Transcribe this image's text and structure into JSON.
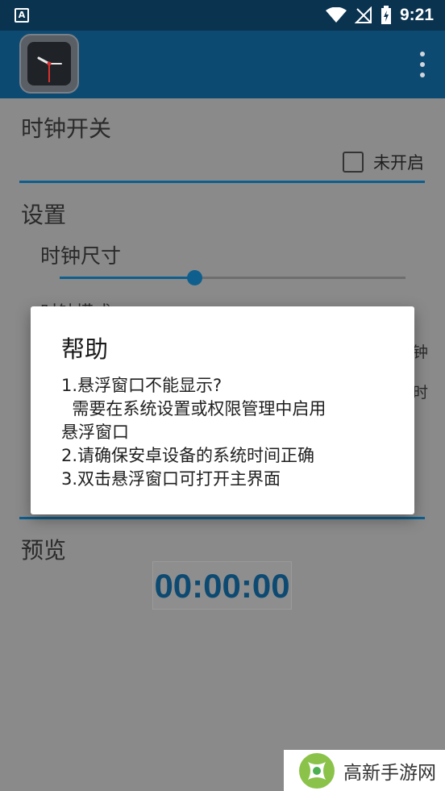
{
  "status_bar": {
    "time": "9:21",
    "app_icon_letter": "A",
    "icons": [
      "wifi-icon",
      "no-signal-icon",
      "battery-charging-icon"
    ]
  },
  "toolbar": {
    "logo": "clock-app-logo",
    "menu_icon": "overflow-menu-icon"
  },
  "sections": {
    "clock_switch": {
      "title": "时钟开关",
      "checkbox_label": "未开启",
      "checked": false
    },
    "settings": {
      "title": "设置",
      "clock_size_label": "时钟尺寸",
      "clock_size_value": 0.39,
      "partial_label": "时钟模式",
      "right_fragments": [
        "钟",
        "时"
      ]
    },
    "preview": {
      "title": "预览",
      "clock_text": "00:00:00"
    }
  },
  "dialog": {
    "title": "帮助",
    "lines": [
      "1.悬浮窗口不能显示?",
      "  需要在系统设置或权限管理中启用",
      "悬浮窗口",
      "2.请确保安卓设备的系统时间正确",
      "3.双击悬浮窗口可打开主界面"
    ]
  },
  "watermark": {
    "text": "高新手游网"
  },
  "colors": {
    "status_bar": "#0a3350",
    "toolbar": "#0d4a72",
    "accent": "#0e5f8e",
    "scrim_background": "#8a8a8a",
    "dialog": "#ffffff"
  }
}
